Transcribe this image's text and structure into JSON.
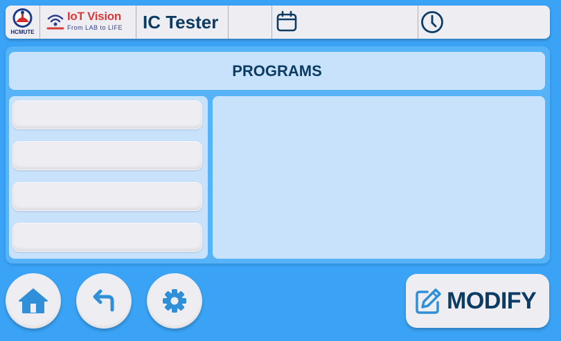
{
  "header": {
    "logo_hcmute_label": "HCMUTE",
    "logo_iot_main": "IoT Vision",
    "logo_iot_sub": "From LAB to LIFE",
    "title": "IC Tester",
    "calendar_icon": "calendar-icon",
    "clock_icon": "clock-icon"
  },
  "main": {
    "section_title": "PROGRAMS",
    "program_items": [
      "",
      "",
      "",
      ""
    ]
  },
  "footer": {
    "home_icon": "home-icon",
    "back_icon": "back-arrow-icon",
    "settings_icon": "gear-icon",
    "modify_label": "MODIFY",
    "modify_icon": "edit-icon"
  },
  "colors": {
    "background": "#3aa3f5",
    "panel": "#c9e2fc",
    "button": "#eeeef2",
    "text_dark": "#0c3c63",
    "icon_blue": "#2f8fd8"
  }
}
